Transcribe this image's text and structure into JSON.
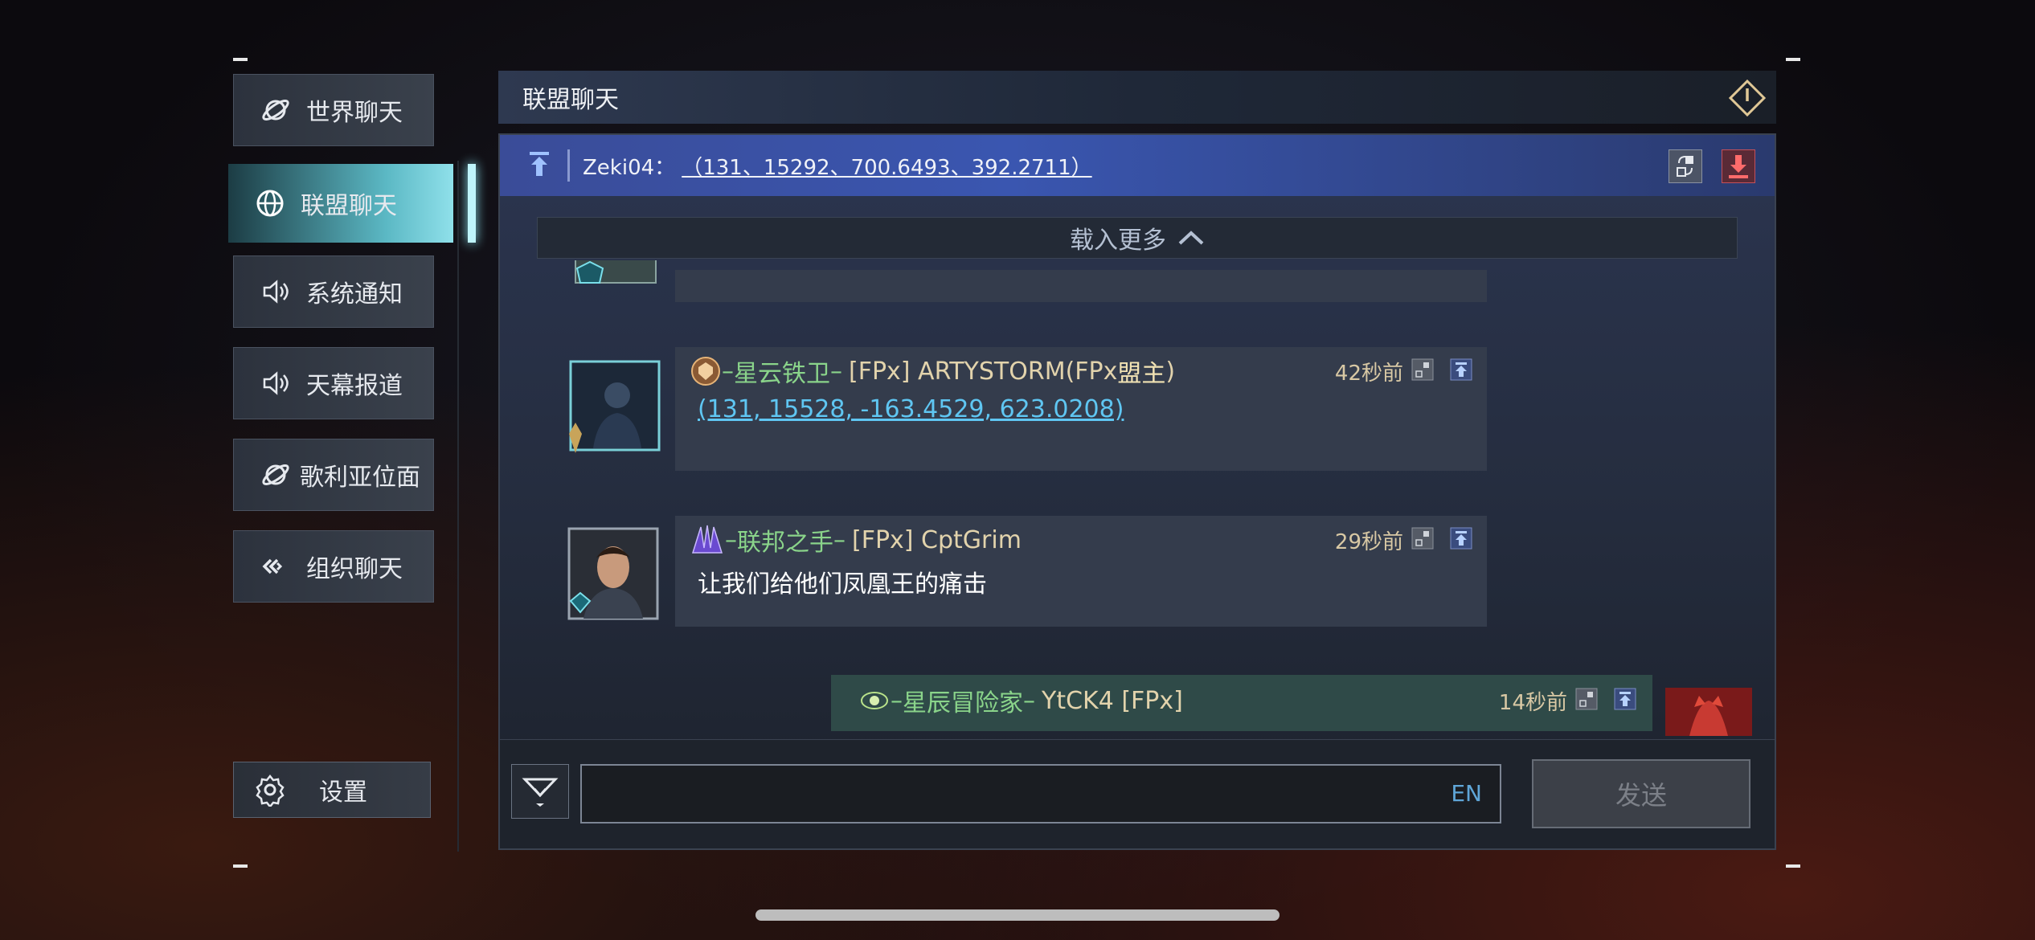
{
  "sidebar": {
    "items": [
      {
        "label": "世界聊天",
        "icon": "planet-icon"
      },
      {
        "label": "联盟聊天",
        "icon": "globe-icon"
      },
      {
        "label": "系统通知",
        "icon": "speaker-icon"
      },
      {
        "label": "天幕报道",
        "icon": "speaker-icon"
      },
      {
        "label": "歌利亚位面",
        "icon": "planet-icon"
      },
      {
        "label": "组织聊天",
        "icon": "link-icon"
      }
    ],
    "active_index": 1,
    "settings_label": "设置"
  },
  "header": {
    "title": "联盟聊天"
  },
  "pinned": {
    "sender": "Zeki04：",
    "content": "（131、15292、700.6493、392.2711）"
  },
  "load_more": "载入更多",
  "messages": [
    {
      "prefix": "–",
      "title": "星云铁卫",
      "sep": "–",
      "name": "[FPx] ARTYSTORM(FPx",
      "name_highlight": "盟主",
      "name_suffix": ")",
      "time": "42秒前",
      "body": "(131, 15528, -163.4529, 623.0208)"
    },
    {
      "prefix": "–",
      "title": "联邦之手",
      "sep": "–",
      "name": "[FPx] CptGrim",
      "time": "29秒前",
      "body": "让我们给他们凤凰王的痛击"
    },
    {
      "prefix": "–",
      "title": "星辰冒险家",
      "sep": "–",
      "name": "YtCK4 [FPx]",
      "time": "14秒前"
    }
  ],
  "input": {
    "lang": "EN",
    "placeholder": ""
  },
  "send_label": "发送",
  "colors": {
    "accent_cyan": "#8fe0ea",
    "title_green": "#8ad48a",
    "link_blue": "#5fc6f2",
    "pinned_blue": "#3a56b0"
  }
}
